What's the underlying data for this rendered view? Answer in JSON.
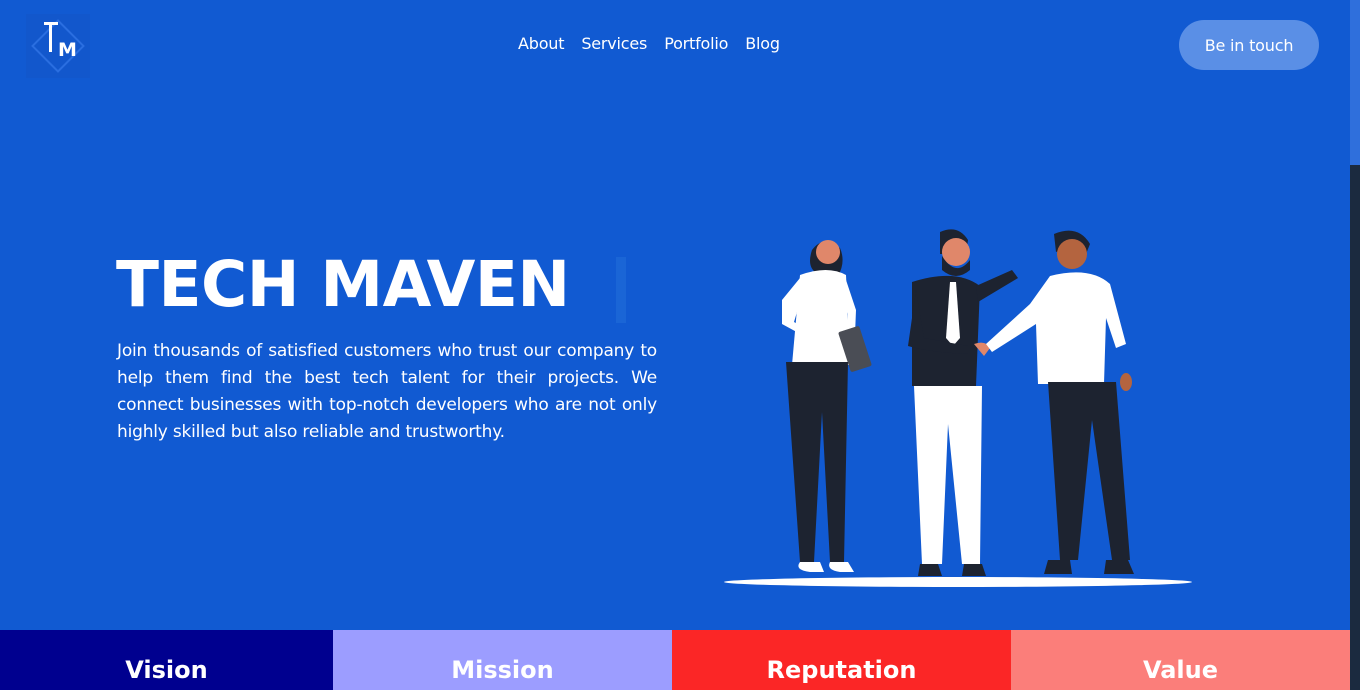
{
  "brand": {
    "logo_text": "TM",
    "logo_alt": "tm-logo"
  },
  "nav": {
    "items": [
      {
        "label": "About"
      },
      {
        "label": "Services"
      },
      {
        "label": "Portfolio"
      },
      {
        "label": "Blog"
      }
    ]
  },
  "header": {
    "cta_label": "Be in touch"
  },
  "hero": {
    "title": "TECH MAVEN",
    "description": "Join thousands of satisfied customers who trust our company to help them find the best tech talent for their projects. We connect businesses with top-notch developers who are not only highly skilled but also reliable and trustworthy."
  },
  "tabs": [
    {
      "label": "Vision",
      "color": "#00008f"
    },
    {
      "label": "Mission",
      "color": "#9c9dff"
    },
    {
      "label": "Reputation",
      "color": "#fb2626"
    },
    {
      "label": "Value",
      "color": "#fb7e7a"
    }
  ],
  "colors": {
    "background": "#115ad2",
    "cta_bg": "#5a8fe6"
  }
}
